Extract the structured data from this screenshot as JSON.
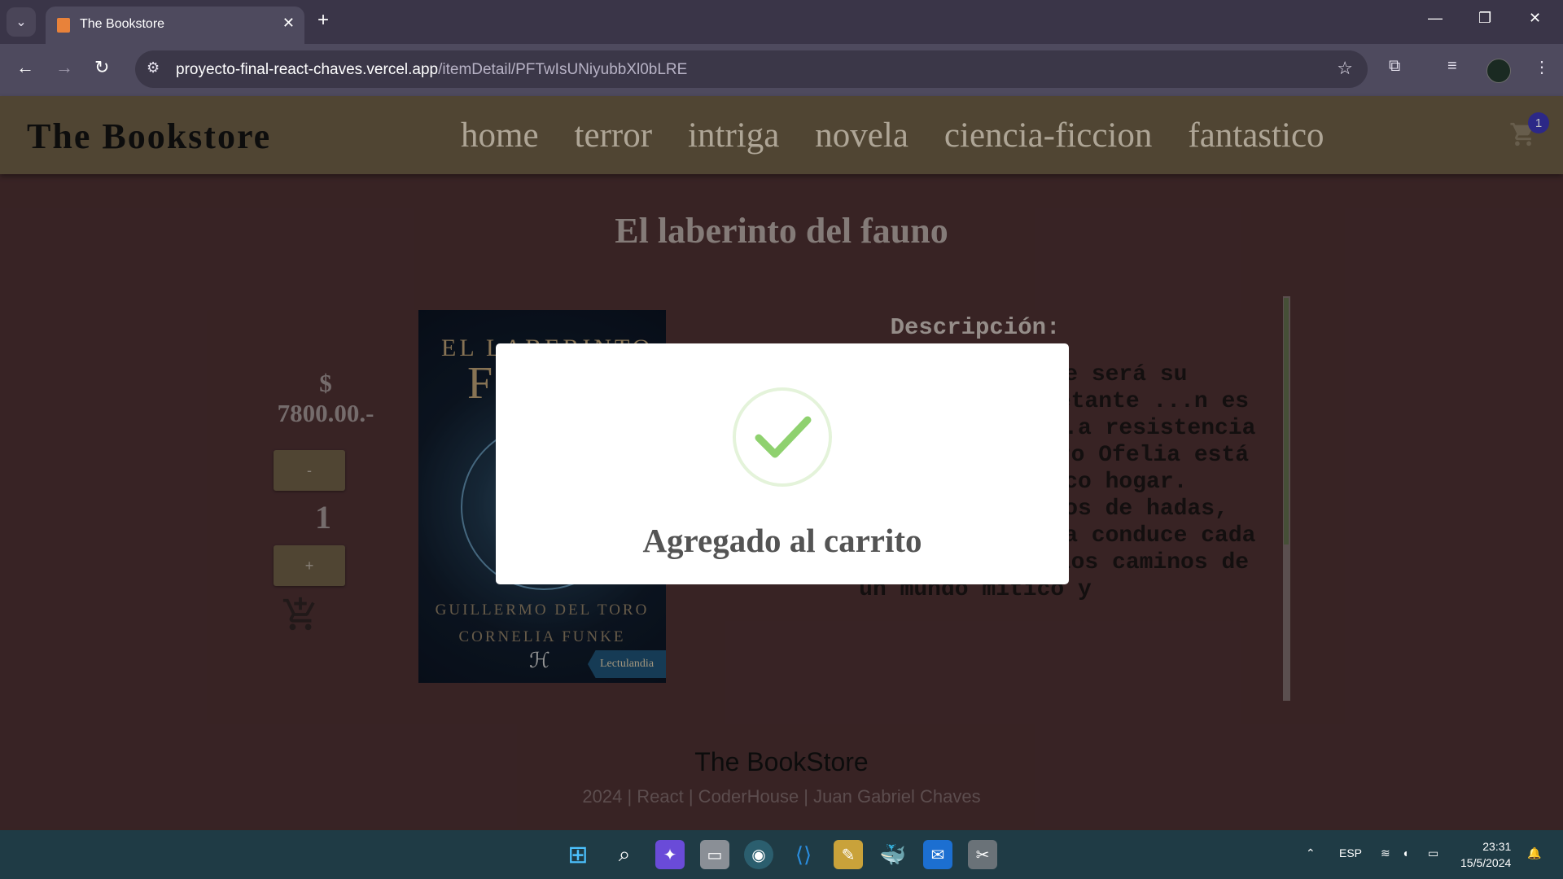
{
  "browser": {
    "tab_title": "The Bookstore",
    "url_host": "proyecto-final-react-chaves.vercel.app",
    "url_path": "/itemDetail/PFTwIsUNiyubbXl0bLRE"
  },
  "header": {
    "brand": "The Bookstore",
    "nav": [
      "home",
      "terror",
      "intriga",
      "novela",
      "ciencia-ficcion",
      "fantastico"
    ],
    "cart_count": "1"
  },
  "book": {
    "title": "El laberinto del fauno",
    "price_symbol": "$",
    "price": "7800.00.-",
    "minus_label": "-",
    "quantity": "1",
    "plus_label": "+",
    "cover": {
      "top_text": "EL LABERINTO",
      "big_letter": "F",
      "authors_1": "GUILLERMO DEL TORO",
      "authors_2": "CORNELIA FUNKE",
      "logo_glyph": "ℋ",
      "publisher": "Lectulandia"
    },
    "description_label": "Descripción:",
    "description_visible": "...tre pantanos, ...que será su ...capitán del ...el inquietante ...n es como una ...de escondite ...a resistencia ...cienta guerra civil. Pero Ofelia está embelesada con su mágico hogar. Obsesionada con los cuentos de hadas, descubre un laberinto que la conduce cada vez más profundamente por los caminos de un mundo mítico y"
  },
  "footer": {
    "title": "The BookStore",
    "subtitle": "2024 | React | CoderHouse | Juan Gabriel Chaves"
  },
  "modal": {
    "title": "Agregado al carrito",
    "icon": "check-icon",
    "icon_color": "#8fd16f"
  },
  "taskbar": {
    "lang": "ESP",
    "time": "23:31",
    "date": "15/5/2024"
  },
  "colors": {
    "page_bg": "#4b2f31",
    "header_bg": "#6b5c44",
    "badge": "#3b36b5"
  }
}
